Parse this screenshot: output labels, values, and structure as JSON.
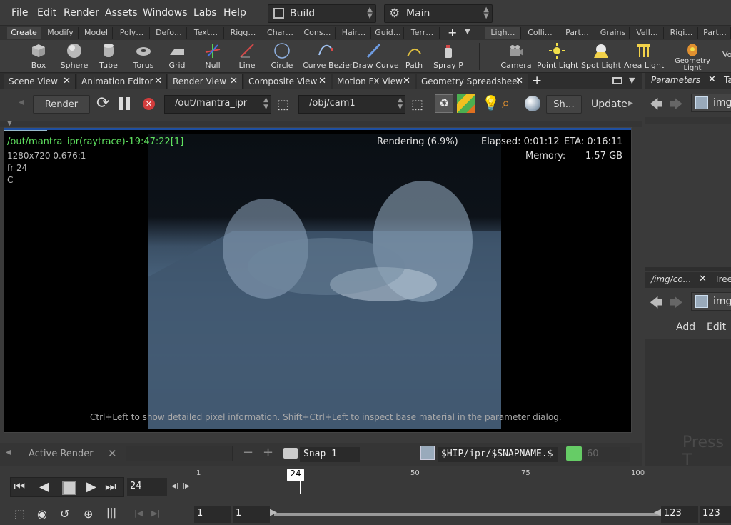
{
  "menu": [
    "File",
    "Edit",
    "Render",
    "Assets",
    "Windows",
    "Labs",
    "Help"
  ],
  "desktop": {
    "value": "Build",
    "icon": "desktop-layout-icon"
  },
  "context": {
    "value": "Main",
    "icon": "gear-icon"
  },
  "shelf_tabs_left": [
    "Create",
    "Modify",
    "Model",
    "Poly…",
    "Defo…",
    "Text…",
    "Rigg…",
    "Char…",
    "Cons…",
    "Hair…",
    "Guid…",
    "Terr…"
  ],
  "shelf_tabs_right": [
    "Ligh…",
    "Colli…",
    "Part…",
    "Grains",
    "Vell…",
    "Rigi…",
    "Part…"
  ],
  "shelf_tools_left": [
    {
      "label": "Box",
      "icon": "box-icon"
    },
    {
      "label": "Sphere",
      "icon": "sphere-icon"
    },
    {
      "label": "Tube",
      "icon": "tube-icon"
    },
    {
      "label": "Torus",
      "icon": "torus-icon"
    },
    {
      "label": "Grid",
      "icon": "grid-icon"
    },
    {
      "label": "Null",
      "icon": "null-icon"
    },
    {
      "label": "Line",
      "icon": "line-icon"
    },
    {
      "label": "Circle",
      "icon": "circle-icon"
    },
    {
      "label": "Curve Bezier",
      "icon": "curve-bezier-icon"
    },
    {
      "label": "Draw Curve",
      "icon": "draw-curve-icon"
    },
    {
      "label": "Path",
      "icon": "path-icon"
    },
    {
      "label": "Spray P",
      "icon": "spray-paint-icon"
    }
  ],
  "shelf_tools_right": [
    {
      "label": "Camera",
      "icon": "camera-icon"
    },
    {
      "label": "Point Light",
      "icon": "point-light-icon"
    },
    {
      "label": "Spot Light",
      "icon": "spot-light-icon"
    },
    {
      "label": "Area Light",
      "icon": "area-light-icon"
    },
    {
      "label": "Geometry Light",
      "icon": "geometry-light-icon"
    }
  ],
  "pane_tabs": [
    "Scene View",
    "Animation Editor",
    "Render View",
    "Composite View",
    "Motion FX View",
    "Geometry Spreadsheet"
  ],
  "active_pane_tab": "Render View",
  "render_toolbar": {
    "render_button": "Render",
    "driver_path": "/out/mantra_ipr",
    "camera_path": "/obj/cam1",
    "sh_label": "Sh…",
    "update_label": "Update"
  },
  "overlay": {
    "title": "/out/mantra_ipr(raytrace)-19:47:22[1]",
    "resolution": "1280x720  0.676:1",
    "frame": "fr 24",
    "channel": "C",
    "status": "Rendering (6.9%)",
    "elapsed": "Elapsed: 0:01:12",
    "eta": "ETA: 0:16:11",
    "memory_label": "Memory:",
    "memory_value": "1.57 GB",
    "hint": "Ctrl+Left to show detailed pixel information. Shift+Ctrl+Left to inspect base material in the parameter dialog."
  },
  "statusbar": {
    "active_render": "Active Render",
    "snap_name": "Snap  1",
    "snap_path": "$HIP/ipr/$SNAPNAME.$",
    "snap_count": "60"
  },
  "timeline": {
    "current_frame": "24",
    "marker": "24",
    "ticks": [
      "1",
      "50",
      "75",
      "100"
    ],
    "range_start": "1",
    "range_start2": "1",
    "range_end": "123",
    "range_end2": "123"
  },
  "right_pane": {
    "tab1": "Parameters",
    "tab1b": "Ta",
    "net1": "img",
    "tab2": "/img/co…",
    "tab2b": "Tree",
    "net2": "img",
    "add": "Add",
    "edit": "Edit",
    "press": "Press T"
  },
  "colors": {
    "overlay_title": "#5fe05f",
    "accent_bar": "#1f4fa0",
    "close_red": "#d23c3c"
  }
}
